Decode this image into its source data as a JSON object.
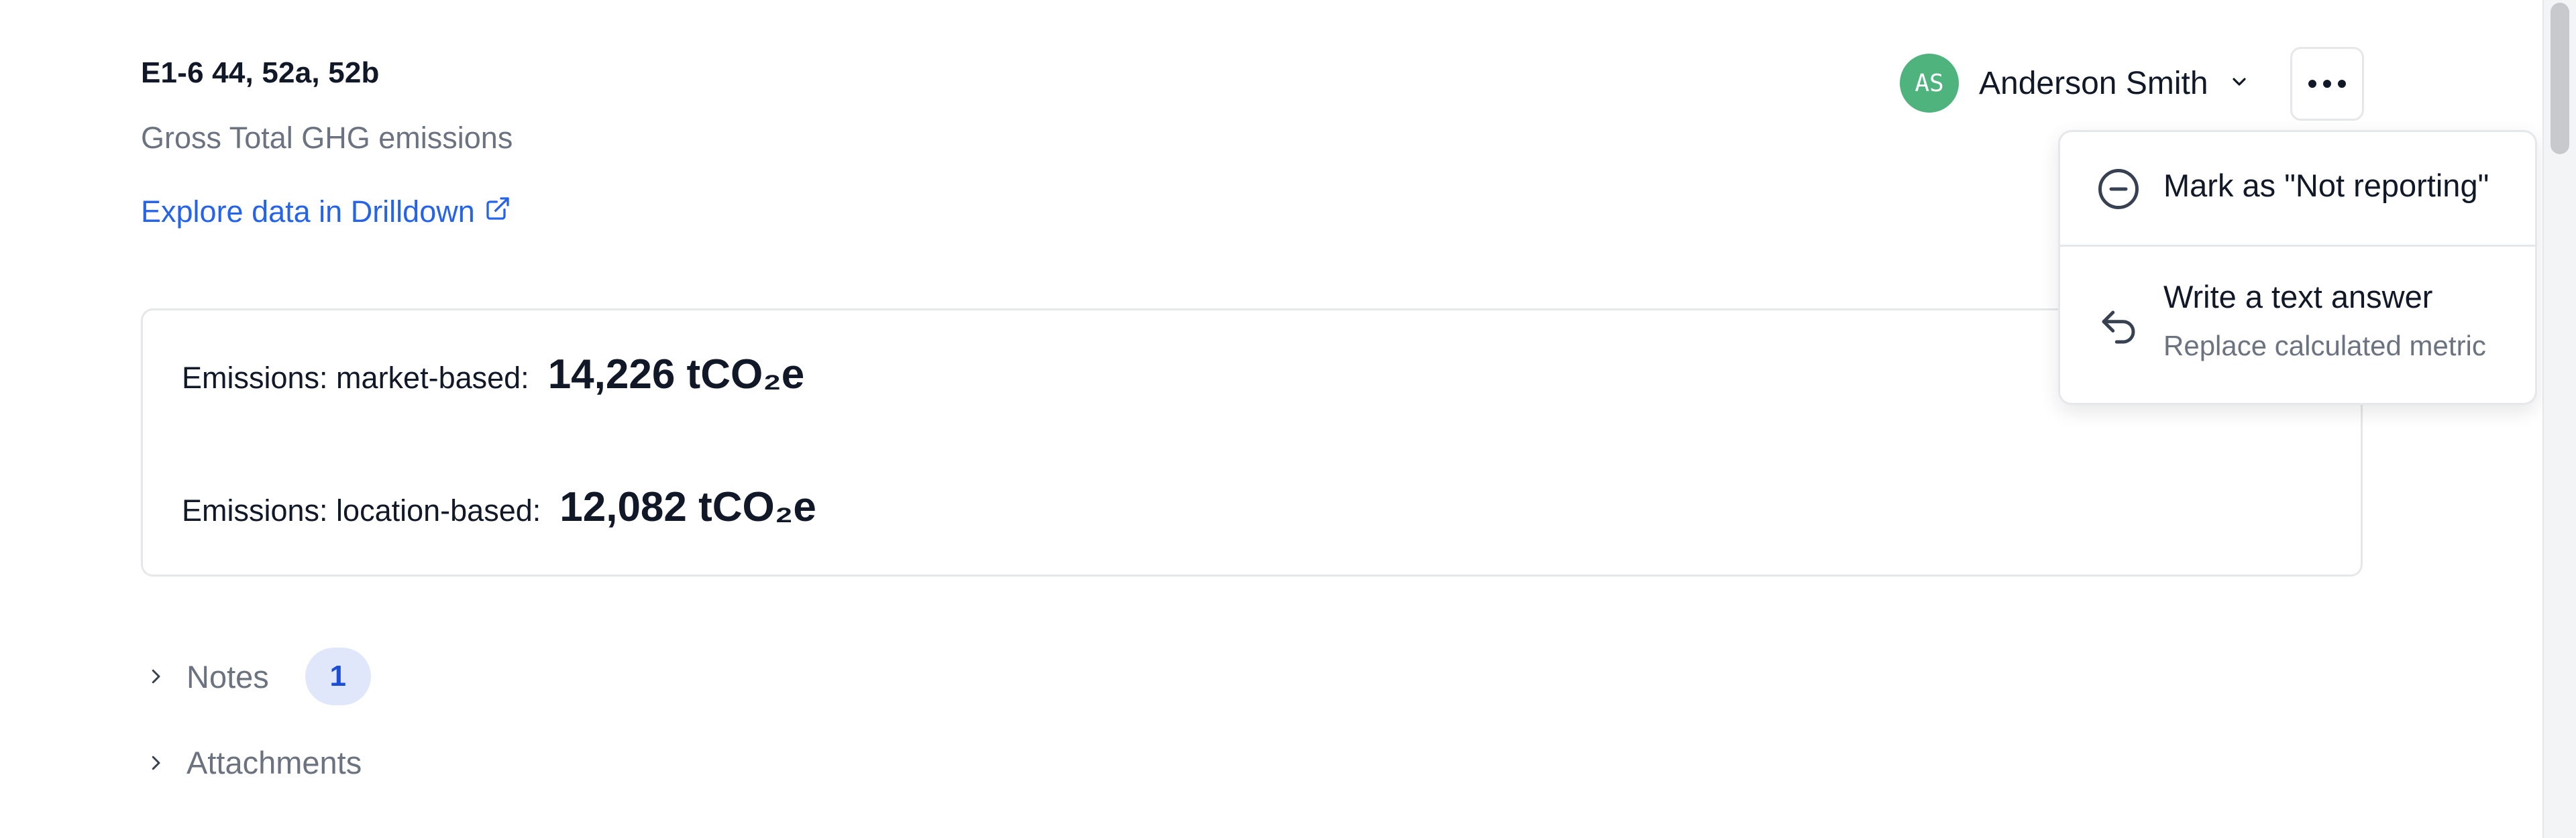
{
  "header": {
    "code": "E1-6 44, 52a, 52b",
    "subtitle": "Gross Total GHG emissions",
    "drilldown_link": "Explore data in Drilldown"
  },
  "metrics": [
    {
      "label": "Emissions: market-based:",
      "value": "14,226 tCO₂e"
    },
    {
      "label": "Emissions: location-based:",
      "value": "12,082 tCO₂e"
    }
  ],
  "sections": {
    "notes": {
      "label": "Notes",
      "count": "1"
    },
    "attachments": {
      "label": "Attachments"
    }
  },
  "assignee": {
    "initials": "AS",
    "name": "Anderson Smith",
    "avatar_color": "#4fb37e"
  },
  "more_menu": {
    "items": [
      {
        "title": "Mark as \"Not reporting\"",
        "icon": "minus-circle-icon"
      },
      {
        "title": "Write a text answer",
        "subtitle": "Replace calculated metric",
        "icon": "undo-arrow-icon"
      }
    ]
  },
  "colors": {
    "link": "#2563eb",
    "badge_bg": "#e0e7fb",
    "badge_text": "#1d4ed8"
  }
}
